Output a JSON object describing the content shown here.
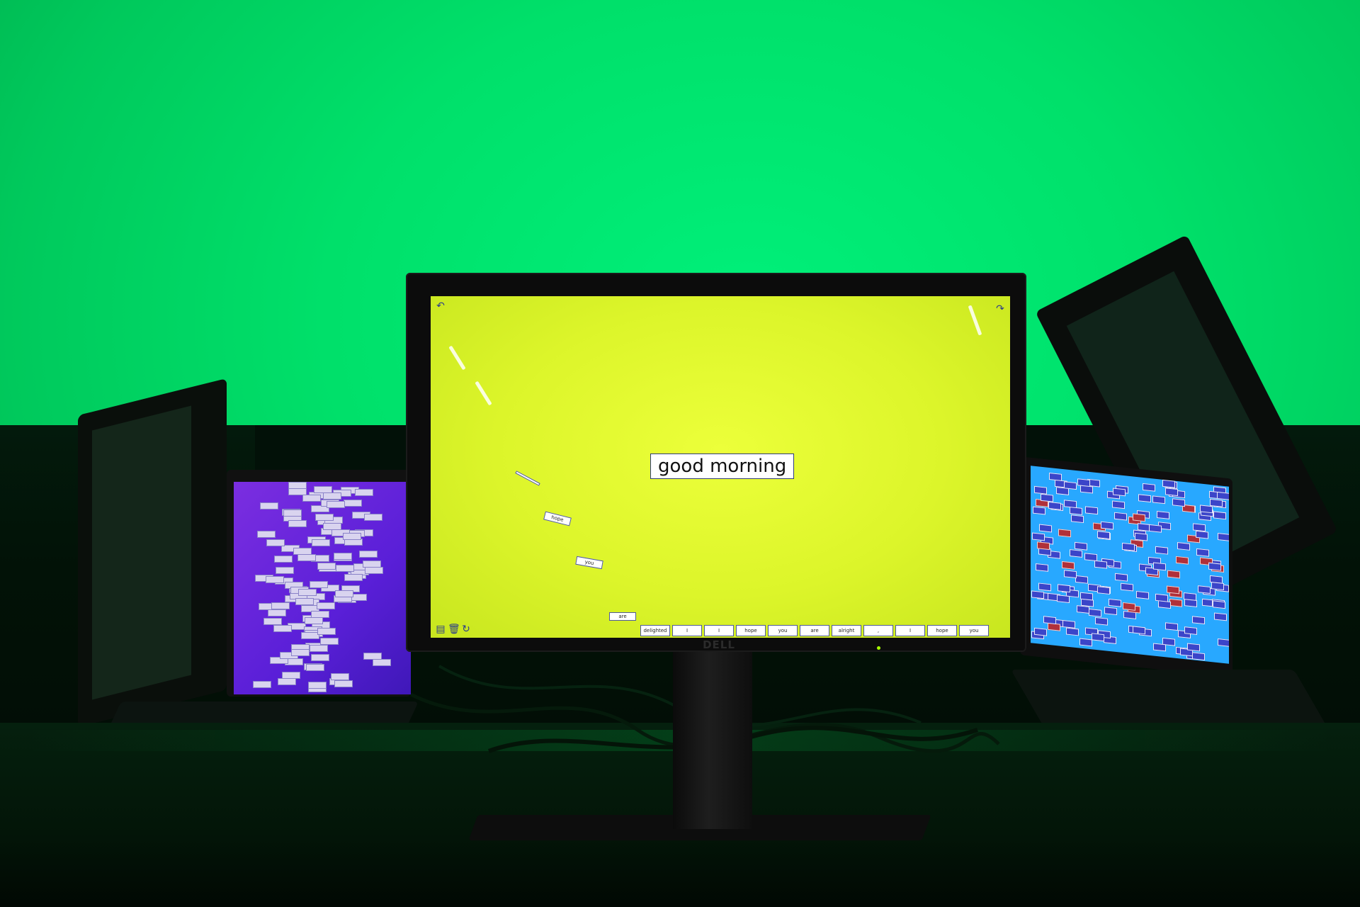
{
  "main_monitor": {
    "brand": "DELL",
    "headline": "good morning",
    "floating_tiles": [
      "hope",
      "you",
      "are"
    ],
    "word_bar": [
      "delighted",
      "I",
      "I",
      "hope",
      "you",
      "are",
      "alright",
      ",",
      "I",
      "hope",
      "you"
    ],
    "icons": [
      "undo-icon",
      "redo-icon",
      "archive-icon",
      "trash-icon",
      "refresh-icon"
    ]
  },
  "colors": {
    "backdrop": "#00e06a",
    "main_screen": "#dcf52a",
    "left_laptop_screen": "#5a1fd8",
    "right_laptop_screen": "#28a8ff"
  }
}
